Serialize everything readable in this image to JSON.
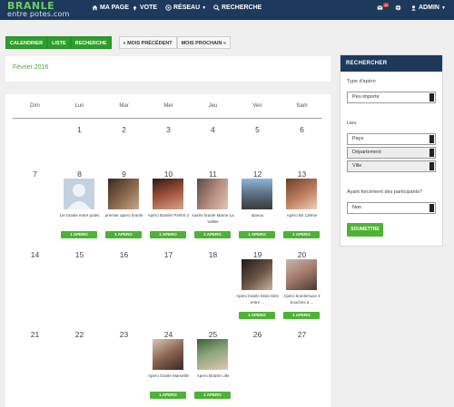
{
  "logo": {
    "line1": "BRANLE",
    "line2": "entre potes.com"
  },
  "nav": {
    "ma_page": "MA PAGE",
    "vote": "VOTE",
    "reseau": "RÉSEAU",
    "recherche": "RECHERCHE",
    "notif_count": "45",
    "admin": "ADMIN"
  },
  "tabs": {
    "calendrier": "CALENDRIER",
    "liste": "LISTE",
    "recherche": "RECHERCHE",
    "precedent": "« MOIS PRÉCÉDENT",
    "prochain": "MOIS PROCHAIN »"
  },
  "month": "Février 2016",
  "weekdays": [
    "Dim",
    "Lun",
    "Mar",
    "Mer",
    "Jeu",
    "Ven",
    "Sam"
  ],
  "weeks": [
    [
      "",
      "1",
      "2",
      "3",
      "4",
      "5",
      "6"
    ],
    [
      "7",
      "8",
      "9",
      "10",
      "11",
      "12",
      "13"
    ],
    [
      "14",
      "15",
      "16",
      "17",
      "18",
      "19",
      "20"
    ],
    [
      "21",
      "22",
      "23",
      "24",
      "25",
      "26",
      "27"
    ]
  ],
  "events": {
    "w2d1": {
      "caption": "1er branle entre potes",
      "button": "1 APERO"
    },
    "w2d2": {
      "caption": "premier apero branle",
      "button": "1 APERO"
    },
    "w2d3": {
      "caption": "Apéro Branle/ PARIS 2",
      "button": "1 APERO"
    },
    "w2d4": {
      "caption": "soirée branle Marne La Vallee",
      "button": "1 APERO"
    },
    "w2d5": {
      "caption": "alanou",
      "button": "1 APERO"
    },
    "w2d6": {
      "caption": "Apéro Bri 13ème",
      "button": "1 APERO"
    },
    "w3d5": {
      "caption": "Apéro branle bédo tière entre ...",
      "button": "1 APERO"
    },
    "w3d6": {
      "caption": "Apéro branle/suce 2 bouches à ...",
      "button": "1 APERO"
    },
    "w4d3": {
      "caption": "Apero branle Marseille",
      "button": "1 APERO"
    },
    "w4d4": {
      "caption": "Apero Branle Lille",
      "button": "1 APERO"
    }
  },
  "sidebar": {
    "title": "RECHERCHER",
    "type_label": "Type d'apéro",
    "type_value": "Peu importe",
    "lieu_label": "Lieu",
    "pays": "Pays",
    "departement": "Département",
    "ville": "Ville",
    "participants_label": "Ayant forcément des participants?",
    "participants_value": "Non",
    "submit": "SOUMETTRE"
  },
  "colors": {
    "nav": "#1d3a5c",
    "green": "#4db335",
    "accent": "#4aa33f"
  },
  "icons": [
    "home-icon",
    "vote-icon",
    "network-icon",
    "search-icon",
    "mail-icon",
    "globe-icon",
    "user-icon"
  ]
}
